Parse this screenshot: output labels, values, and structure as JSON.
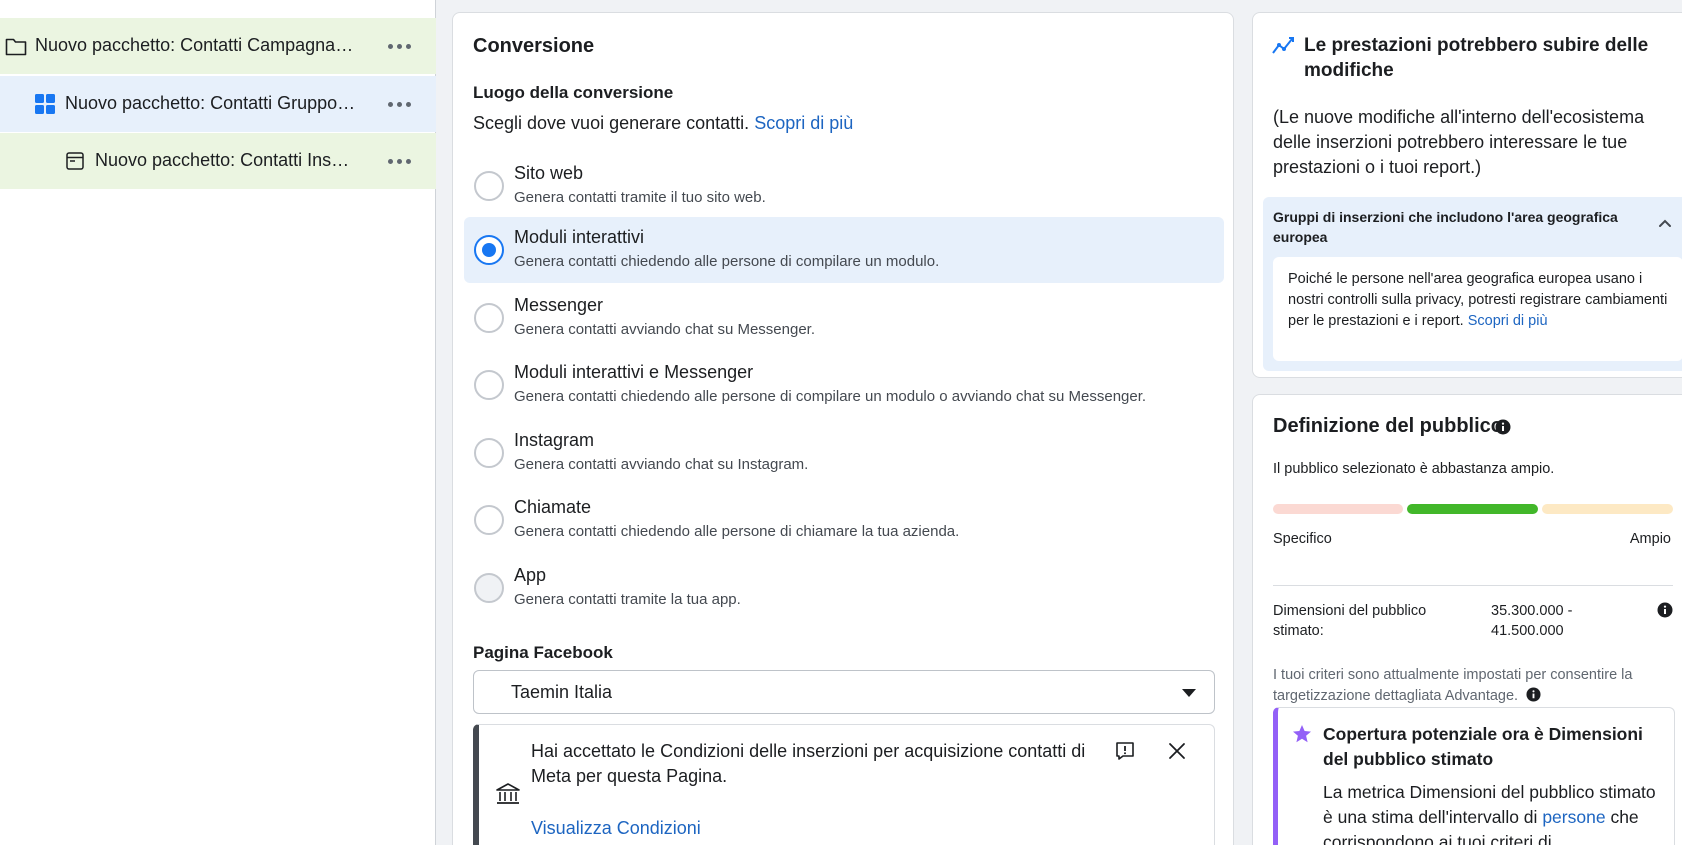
{
  "tree": {
    "campaign": {
      "label": "Nuovo pacchetto: Contatti Campagna c..."
    },
    "adset": {
      "label": "Nuovo pacchetto: Contatti Gruppo d..."
    },
    "ad": {
      "label": "Nuovo pacchetto: Contatti Inser..."
    }
  },
  "conversion": {
    "title": "Conversione",
    "location_label": "Luogo della conversione",
    "location_desc": "Scegli dove vuoi generare contatti.",
    "learn_more": "Scopri di più",
    "options": [
      {
        "title": "Sito web",
        "desc": "Genera contatti tramite il tuo sito web.",
        "state": "unselected"
      },
      {
        "title": "Moduli interattivi",
        "desc": "Genera contatti chiedendo alle persone di compilare un modulo.",
        "state": "selected"
      },
      {
        "title": "Messenger",
        "desc": "Genera contatti avviando chat su Messenger.",
        "state": "unselected"
      },
      {
        "title": "Moduli interattivi e Messenger",
        "desc": "Genera contatti chiedendo alle persone di compilare un modulo o avviando chat su Messenger.",
        "state": "unselected"
      },
      {
        "title": "Instagram",
        "desc": "Genera contatti avviando chat su Instagram.",
        "state": "unselected"
      },
      {
        "title": "Chiamate",
        "desc": "Genera contatti chiedendo alle persone di chiamare la tua azienda.",
        "state": "unselected"
      },
      {
        "title": "App",
        "desc": "Genera contatti tramite la tua app.",
        "state": "disabled"
      }
    ],
    "page_label": "Pagina Facebook",
    "page_value": "Taemin Italia",
    "notice_text": "Hai accettato le Condizioni delle inserzioni per acquisizione contatti di Meta per questa Pagina.",
    "notice_link": "Visualizza Condizioni"
  },
  "performance": {
    "title": "Le prestazioni potrebbero subire delle modifiche",
    "body": "(Le nuove modifiche all'interno dell'ecosistema delle inserzioni potrebbero interessare le tue prestazioni o i tuoi report.)",
    "accordion_title": "Gruppi di inserzioni che includono l'area geografica europea",
    "accordion_text": "Poiché le persone nell'area geografica europea usano i nostri controlli sulla privacy, potresti registrare cambiamenti per le prestazioni e i report.",
    "accordion_link": "Scopri di più"
  },
  "audience": {
    "title": "Definizione del pubblico",
    "status": "Il pubblico selezionato è abbastanza ampio.",
    "meter_left": "Specifico",
    "meter_right": "Ampio",
    "meter_level": "middle",
    "size_label": "Dimensioni del pubblico stimato:",
    "size_value": "35.300.000 - 41.500.000",
    "criteria": "I tuoi criteri sono attualmente impostati per consentire la targetizzazione dettagliata Advantage.",
    "reach_title": "Copertura potenziale ora è Dimensioni del pubblico stimato",
    "reach_body": "La metrica Dimensioni del pubblico stimato è una stima dell'intervallo di",
    "reach_link": "persone",
    "reach_body_end": "che corrispondono ai tuoi criteri di"
  },
  "colors": {
    "accent": "#1877f2",
    "link": "#1d65c1",
    "meter_low": "#fbd9d3",
    "meter_mid": "#42b72a",
    "meter_high": "#fde9c4",
    "reach_accent": "#9360f7"
  },
  "icons": {
    "campaign": "folder-icon",
    "adset": "grid-icon",
    "ad": "ad-icon",
    "performance": "trend-icon",
    "notice": "bank-icon",
    "reach": "star-icon"
  }
}
